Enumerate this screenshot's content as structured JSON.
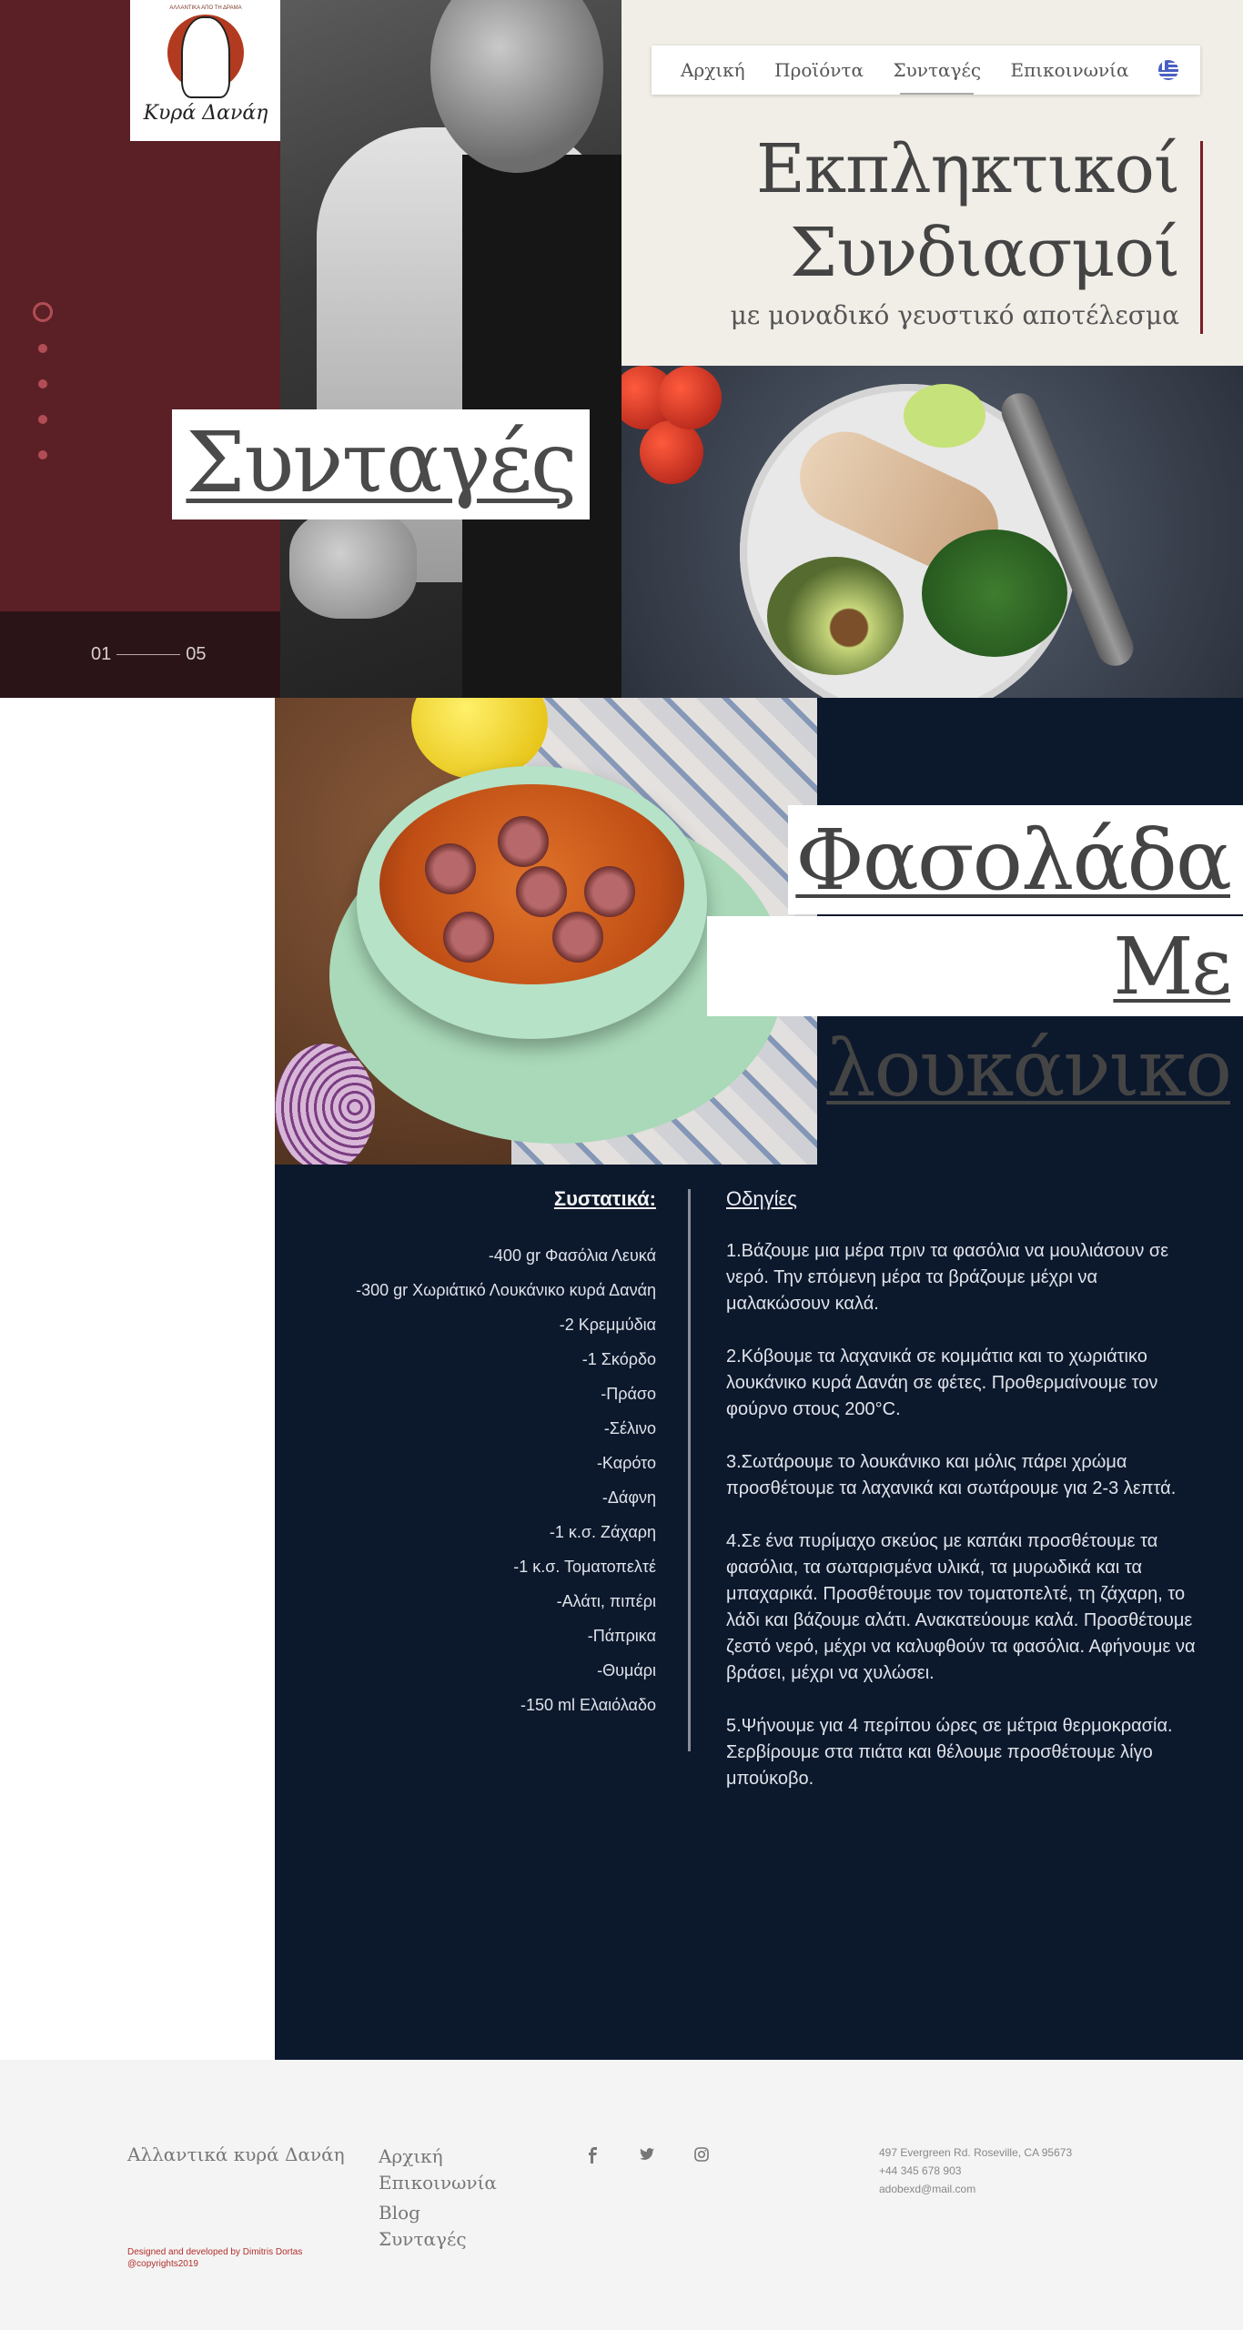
{
  "logo": {
    "name": "Κυρά Δανάη",
    "tagline": "ΑΛΛΑΝΤΙΚΑ ΑΠΟ ΤΗ ΔΡΑΜΑ"
  },
  "hero": {
    "page_title": "Συνταγές",
    "slide_counter": {
      "current": "01",
      "total": "05"
    },
    "heading_line1": "Εκπληκτικοί",
    "heading_line2": "Συνδιασμοί",
    "subheading": "με μοναδικό γευστικό αποτέλεσμα"
  },
  "nav": {
    "items": [
      {
        "label": "Αρχική"
      },
      {
        "label": "Προϊόντα"
      },
      {
        "label": "Συνταγές",
        "active": true
      },
      {
        "label": "Επικοινωνία"
      }
    ],
    "language_icon": "greek-flag-icon"
  },
  "recipe": {
    "title_line1": "Φασολάδα",
    "title_line2": "Με λουκάνικο",
    "ingredients_title": "Συστατικά:",
    "ingredients": [
      "-400 gr Φασόλια Λευκά",
      "-300 gr Χωριάτικό Λουκάνικο κυρά Δανάη",
      "-2 Κρεμμύδια",
      "-1 Σκόρδο",
      "-Πράσο",
      "-Σέλινο",
      "-Καρότο",
      "-Δάφνη",
      "-1 κ.σ. Ζάχαρη",
      "-1 κ.σ. Τοματοπελτέ",
      "-Αλάτι, πιπέρι",
      "-Πάπρικα",
      "-Θυμάρι",
      "-150 ml Ελαιόλαδο"
    ],
    "instructions_title": "Οδηγίες",
    "instructions": [
      "1.Βάζουμε μια μέρα πριν τα φασόλια να μουλιάσουν σε νερό. Την επόμενη μέρα τα βράζουμε μέχρι να μαλακώσουν καλά.",
      "2.Κόβουμε τα λαχανικά σε κομμάτια και το χωριάτικο λουκάνικο κυρά Δανάη σε φέτες. Προθερμαίνουμε τον φούρνο στους 200°C.",
      "3.Σωτάρουμε το λουκάνικο και μόλις πάρει χρώμα προσθέτουμε τα λαχανικά και σωτάρουμε για 2-3 λεπτά.",
      "4.Σε ένα πυρίμαχο σκεύος με καπάκι προσθέτουμε τα φασόλια, τα σωταρισμένα υλικά, τα μυρωδικά και τα μπαχαρικά. Προσθέτουμε τον τοματοπελτέ, τη ζάχαρη, το λάδι και βάζουμε αλάτι. Ανακατεύουμε καλά. Προσθέτουμε ζεστό νερό, μέχρι να καλυφθούν τα φασόλια. Αφήνουμε να βράσει, μέχρι να χυλώσει.",
      "5.Ψήνουμε για 4 περίπου ώρες σε μέτρια θερμοκρασία. Σερβίρουμε στα πιάτα και θέλουμε προσθέτουμε λίγο μπούκοβο."
    ]
  },
  "footer": {
    "brand": "Αλλαντικά κυρά Δανάη",
    "nav": [
      "Αρχική",
      "Επικοινωνία",
      "Blog",
      "Συνταγές"
    ],
    "social": [
      "facebook-icon",
      "twitter-icon",
      "instagram-icon"
    ],
    "address": "497 Evergreen Rd. Roseville, CA 95673",
    "phone": "+44 345 678 903",
    "email": "adobexd@mail.com",
    "credit_line1": "Designed and developed by Dimitris Dortas",
    "credit_line2": "@copyrights2019"
  },
  "colors": {
    "burgundy": "#5a2025",
    "navy": "#0c182c",
    "cream": "#f1ede7",
    "accent_red": "#7a1d26"
  }
}
